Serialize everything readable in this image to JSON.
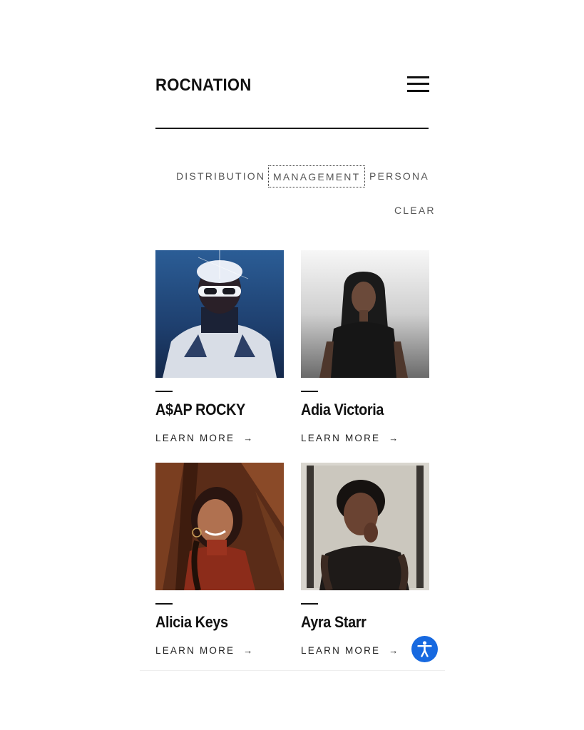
{
  "header": {
    "logo": "ROCNATION",
    "menu_icon": "hamburger-menu-icon"
  },
  "filters": {
    "items": [
      "DISTRIBUTION",
      "MANAGEMENT",
      "PERSONALI"
    ],
    "selected": "MANAGEMENT",
    "clear_label": "CLEAR"
  },
  "artists": [
    {
      "name": "A$AP ROCKY",
      "cta": "LEARN MORE"
    },
    {
      "name": "Adia Victoria",
      "cta": "LEARN MORE"
    },
    {
      "name": "Alicia Keys",
      "cta": "LEARN MORE"
    },
    {
      "name": "Ayra Starr",
      "cta": "LEARN MORE"
    }
  ],
  "arrow_glyph": "→",
  "accessibility": {
    "icon": "accessibility-person-icon",
    "color": "#1769e0"
  }
}
